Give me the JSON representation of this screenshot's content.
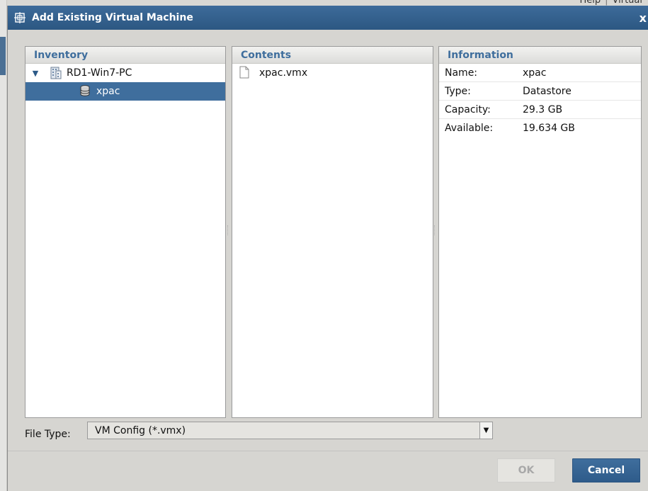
{
  "background": {
    "top_right_text": "Help",
    "top_right_text2": "Virtual"
  },
  "dialog": {
    "title": "Add Existing Virtual Machine",
    "close_label": "x",
    "accent_color": "#3f6e9d"
  },
  "inventory": {
    "header": "Inventory",
    "host": {
      "label": "RD1-Win7-PC",
      "icon": "host-building-icon",
      "expanded": true
    },
    "datastore": {
      "label": "xpac",
      "icon": "datastore-icon",
      "selected": true
    }
  },
  "contents": {
    "header": "Contents",
    "files": [
      {
        "name": "xpac.vmx",
        "icon": "file-icon"
      }
    ]
  },
  "information": {
    "header": "Information",
    "rows": [
      {
        "key": "Name:",
        "value": "xpac"
      },
      {
        "key": "Type:",
        "value": "Datastore"
      },
      {
        "key": "Capacity:",
        "value": "29.3 GB"
      },
      {
        "key": "Available:",
        "value": "19.634 GB"
      }
    ]
  },
  "file_type": {
    "label": "File Type:",
    "selected": "VM Config (*.vmx)"
  },
  "buttons": {
    "ok": "OK",
    "cancel": "Cancel"
  }
}
